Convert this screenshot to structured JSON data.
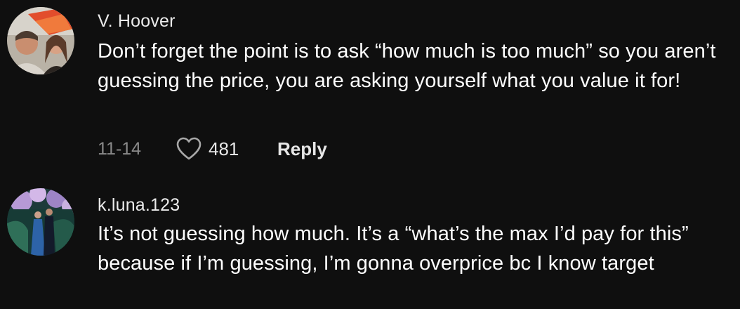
{
  "comments": [
    {
      "username": "V. Hoover",
      "text": "Don’t forget the point is to ask “how much is too much” so you aren’t guessing the price, you are asking yourself what you value it for!",
      "date": "11-14",
      "likes": "481",
      "reply_label": "Reply",
      "avatar_icon": "profile-photo"
    },
    {
      "username": "k.luna.123",
      "text": "It’s not guessing how much. It’s a “what’s the max I’d pay for this” because if I’m guessing, I’m gonna overprice bc I know target",
      "avatar_icon": "profile-photo"
    }
  ],
  "colors": {
    "background": "#0f0f0f",
    "text": "#ffffff",
    "muted": "#8a8a8a"
  },
  "icons": {
    "like": "heart-outline-icon"
  }
}
